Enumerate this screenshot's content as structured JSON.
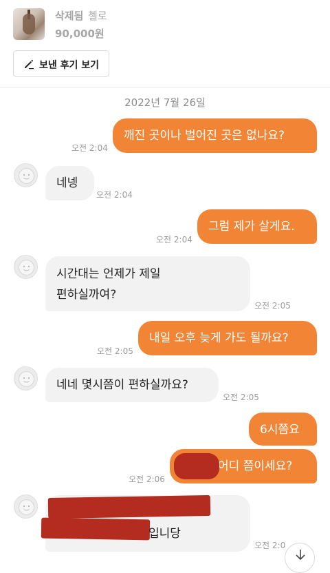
{
  "product": {
    "status": "삭제됨",
    "name": "첼로",
    "price": "90,000원"
  },
  "review_button": {
    "label": "보낸 후기 보기",
    "icon": "pencil-icon"
  },
  "date_divider": "2022년 7월 26일",
  "messages": [
    {
      "sender": "me",
      "text": "깨진 곳이나 벌어진 곳은 없나요?",
      "time": "오전 2:04"
    },
    {
      "sender": "them",
      "text": "네넹",
      "time": "오전 2:04"
    },
    {
      "sender": "me",
      "text": "그럼 제가 살게요.",
      "time": "오전 2:04"
    },
    {
      "sender": "them",
      "lines": [
        "시간대는 언제가 제일",
        "편하실까여?"
      ],
      "time": "오전 2:05"
    },
    {
      "sender": "me",
      "text": "내일 오후 늦게 가도 될까요?",
      "time": "오전 2:05"
    },
    {
      "sender": "them",
      "text": "네네 몇시쯤이 편하실까요?",
      "time": "오전 2:05"
    },
    {
      "sender": "me",
      "text": "6시쯤요",
      "time": ""
    },
    {
      "sender": "me",
      "text": "어디 쯤이세요?",
      "time": "오전 2:06"
    },
    {
      "sender": "them",
      "text": "입니당",
      "time": "오전 2:0"
    }
  ],
  "colors": {
    "accent": "#f28435",
    "incoming_bubble": "#f2f2f3",
    "redaction": "#b42b1f"
  }
}
